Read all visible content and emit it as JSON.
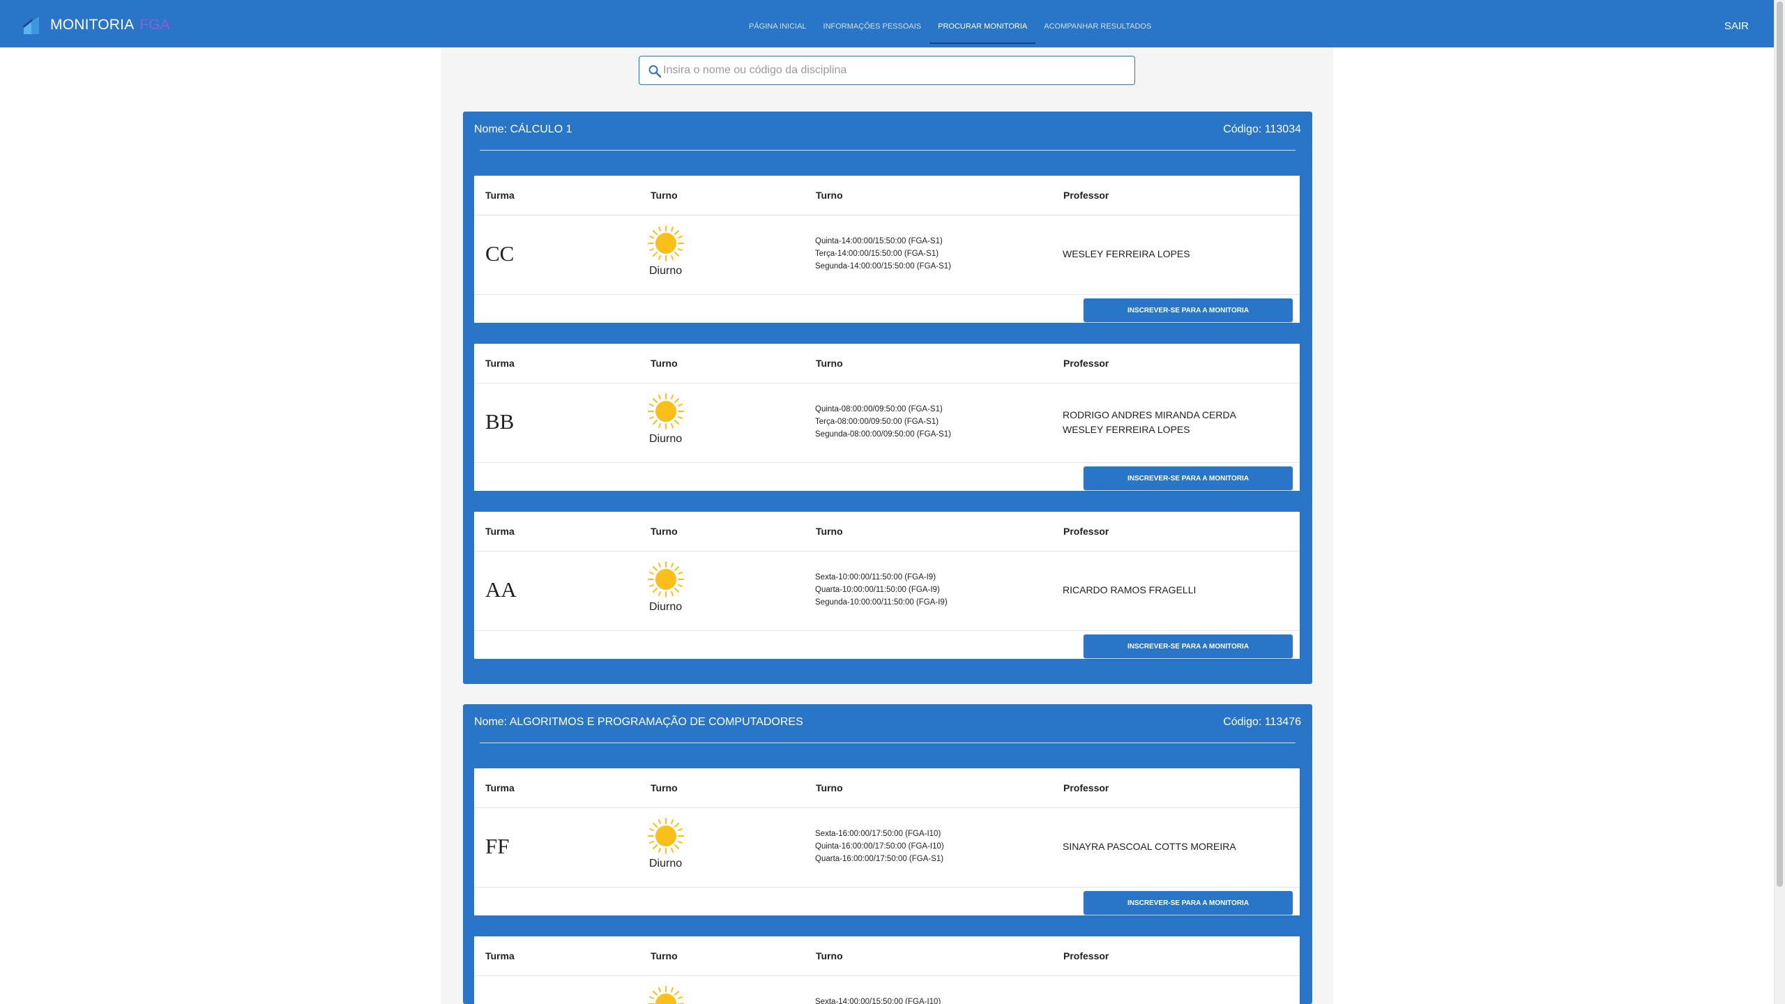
{
  "header": {
    "brand": "MONITORIA",
    "brand_accent": "FGA",
    "nav": [
      {
        "label": "PÁGINA INICIAL",
        "active": false
      },
      {
        "label": "INFORMAÇÕES PESSOAIS",
        "active": false
      },
      {
        "label": "PROCURAR MONITORIA",
        "active": true
      },
      {
        "label": "ACOMPANHAR RESULTADOS",
        "active": false
      }
    ],
    "logout": "SAIR"
  },
  "search": {
    "placeholder": "Insira o nome ou código da disciplina",
    "value": ""
  },
  "table_headers": {
    "turma": "Turma",
    "turno": "Turno",
    "horario": "Turno",
    "professor": "Professor"
  },
  "enroll_label": "INSCREVER-SE PARA A MONITORIA",
  "colors": {
    "primary": "#2976c8",
    "accent": "#8a5fd6",
    "sun": "#fbbf1a"
  },
  "disciplinas": [
    {
      "nome": "Nome: CÁLCULO 1",
      "codigo": "Código: 113034",
      "turmas": [
        {
          "turma": "CC",
          "turno": "Diurno",
          "turno_icon": "sun-icon",
          "horarios": [
            "Quinta-14:00:00/15:50:00 (FGA-S1)",
            "Terça-14:00:00/15:50:00 (FGA-S1)",
            "Segunda-14:00:00/15:50:00 (FGA-S1)"
          ],
          "professores": [
            "WESLEY FERREIRA LOPES"
          ]
        },
        {
          "turma": "BB",
          "turno": "Diurno",
          "turno_icon": "sun-icon",
          "horarios": [
            "Quinta-08:00:00/09:50:00 (FGA-S1)",
            "Terça-08:00:00/09:50:00 (FGA-S1)",
            "Segunda-08:00:00/09:50:00 (FGA-S1)"
          ],
          "professores": [
            "RODRIGO ANDRES MIRANDA CERDA",
            "WESLEY FERREIRA LOPES"
          ]
        },
        {
          "turma": "AA",
          "turno": "Diurno",
          "turno_icon": "sun-icon",
          "horarios": [
            "Sexta-10:00:00/11:50:00 (FGA-I9)",
            "Quarta-10:00:00/11:50:00 (FGA-I9)",
            "Segunda-10:00:00/11:50:00 (FGA-I9)"
          ],
          "professores": [
            "RICARDO RAMOS FRAGELLI"
          ]
        }
      ]
    },
    {
      "nome": "Nome: ALGORITMOS E PROGRAMAÇÃO DE COMPUTADORES",
      "codigo": "Código: 113476",
      "turmas": [
        {
          "turma": "FF",
          "turno": "Diurno",
          "turno_icon": "sun-icon",
          "horarios": [
            "Sexta-16:00:00/17:50:00 (FGA-I10)",
            "Quinta-16:00:00/17:50:00 (FGA-I10)",
            "Quarta-16:00:00/17:50:00 (FGA-S1)"
          ],
          "professores": [
            "SINAYRA PASCOAL COTTS MOREIRA"
          ]
        },
        {
          "turma": "",
          "turno": "",
          "turno_icon": "sun-icon",
          "horarios": [
            "Sexta-14:00:00/15:50:00 (FGA-I10)"
          ],
          "professores": []
        }
      ]
    }
  ]
}
